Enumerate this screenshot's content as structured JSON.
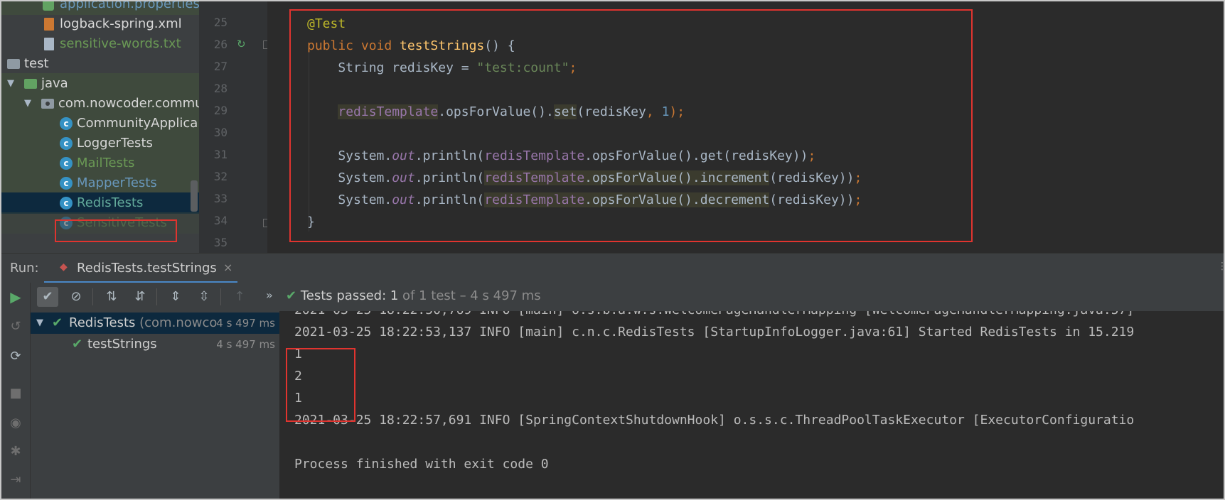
{
  "project_tree": {
    "items": [
      {
        "label": "application.properties",
        "type": "properties"
      },
      {
        "label": "logback-spring.xml",
        "type": "xml"
      },
      {
        "label": "sensitive-words.txt",
        "type": "text"
      },
      {
        "label": "test",
        "type": "folder"
      },
      {
        "label": "java",
        "type": "folder-green"
      },
      {
        "label": "com.nowcoder.commu",
        "type": "package"
      },
      {
        "label": "CommunityApplica",
        "type": "class"
      },
      {
        "label": "LoggerTests",
        "type": "class"
      },
      {
        "label": "MailTests",
        "type": "class"
      },
      {
        "label": "MapperTests",
        "type": "class"
      },
      {
        "label": "RedisTests",
        "type": "class"
      },
      {
        "label": "SensitiveTests",
        "type": "class"
      }
    ]
  },
  "editor": {
    "line_numbers": [
      "25",
      "26",
      "27",
      "28",
      "29",
      "30",
      "31",
      "32",
      "33",
      "34",
      "35"
    ],
    "lines": [
      [
        {
          "t": "@Test",
          "c": "k-ann"
        }
      ],
      [
        {
          "t": "public ",
          "c": "k-key"
        },
        {
          "t": "void ",
          "c": "k-key"
        },
        {
          "t": "testStrings",
          "c": "k-fn"
        },
        {
          "t": "() {",
          "c": ""
        }
      ],
      [
        {
          "t": "    String redisKey = ",
          "c": ""
        },
        {
          "t": "\"test:count\"",
          "c": "k-str"
        },
        {
          "t": ";",
          "c": "k-key"
        }
      ],
      [],
      [
        {
          "t": "    ",
          "c": ""
        },
        {
          "t": "redisTemplate",
          "c": "k-field hl"
        },
        {
          "t": ".opsForValue().",
          "c": ""
        },
        {
          "t": "set",
          "c": "hl"
        },
        {
          "t": "(redisKey",
          "c": ""
        },
        {
          "t": ", ",
          "c": "k-key"
        },
        {
          "t": "1",
          "c": "k-num"
        },
        {
          "t": ");",
          "c": "k-key"
        }
      ],
      [],
      [
        {
          "t": "    System.",
          "c": ""
        },
        {
          "t": "out",
          "c": "k-it"
        },
        {
          "t": ".println(",
          "c": ""
        },
        {
          "t": "redisTemplate",
          "c": "k-field"
        },
        {
          "t": ".opsForValue().get(redisKey))",
          "c": ""
        },
        {
          "t": ";",
          "c": "k-key"
        }
      ],
      [
        {
          "t": "    System.",
          "c": ""
        },
        {
          "t": "out",
          "c": "k-it"
        },
        {
          "t": ".println(",
          "c": ""
        },
        {
          "t": "redisTemplate",
          "c": "k-field hl"
        },
        {
          "t": ".opsForValue().increment",
          "c": "hl"
        },
        {
          "t": "(redisKey))",
          "c": ""
        },
        {
          "t": ";",
          "c": "k-key"
        }
      ],
      [
        {
          "t": "    System.",
          "c": ""
        },
        {
          "t": "out",
          "c": "k-it"
        },
        {
          "t": ".println(",
          "c": ""
        },
        {
          "t": "redisTemplate",
          "c": "k-field hl"
        },
        {
          "t": ".opsForValue().decrement",
          "c": "hl"
        },
        {
          "t": "(redisKey))",
          "c": ""
        },
        {
          "t": ";",
          "c": "k-key"
        }
      ],
      [
        {
          "t": "}",
          "c": ""
        }
      ],
      []
    ]
  },
  "run_panel": {
    "label": "Run:",
    "tab_title": "RedisTests.testStrings",
    "tab_close": "×",
    "status_prefix": "Tests passed: ",
    "status_count": "1",
    "status_rest": " of 1 test – 4 s 497 ms",
    "more": "»",
    "test_tree": [
      {
        "name": "RedisTests",
        "package": " (com.nowco",
        "duration": "4 s 497 ms"
      },
      {
        "name": "testStrings",
        "package": "",
        "duration": "4 s 497 ms"
      }
    ],
    "console": [
      "2021-03-25 18:22:50,769 INFO [main] o.s.b.a.w.s.WelcomePageHandlerMapping [WelcomePageHandlerMapping.java:57]",
      "2021-03-25 18:22:53,137 INFO [main] c.n.c.RedisTests [StartupInfoLogger.java:61] Started RedisTests in 15.219",
      "1",
      "2",
      "1",
      "2021-03-25 18:22:57,691 INFO [SpringContextShutdownHook] o.s.s.c.ThreadPoolTaskExecutor [ExecutorConfiguratio",
      "",
      "Process finished with exit code 0"
    ]
  },
  "colors": {
    "highlight_box": "#e0342f",
    "pass_green": "#59a869",
    "selection": "#0d293e"
  }
}
